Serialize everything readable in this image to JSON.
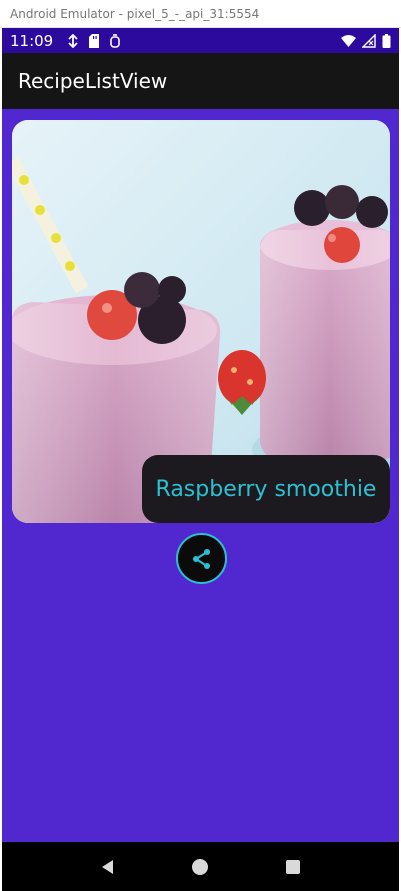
{
  "window": {
    "title": "Android Emulator - pixel_5_-_api_31:5554"
  },
  "status_bar": {
    "time": "11:09",
    "left_icons": [
      "data-saver-icon",
      "sd-card-icon",
      "debug-icon"
    ],
    "right_icons": [
      "wifi-icon",
      "signal-icon",
      "battery-icon"
    ]
  },
  "app_bar": {
    "title": "RecipeListView"
  },
  "recipe": {
    "name": "Raspberry smoothie",
    "image_icon": "raspberry-smoothie-photo"
  },
  "share": {
    "icon": "share-icon"
  },
  "nav_bar": {
    "icons": [
      "back-icon",
      "home-icon",
      "recents-icon"
    ]
  },
  "colors": {
    "background": "#5128cf",
    "status_bar": "#2c0a9e",
    "app_bar": "#151515",
    "label_bg": "#1c1a1e",
    "accent": "#2bc0d3"
  }
}
